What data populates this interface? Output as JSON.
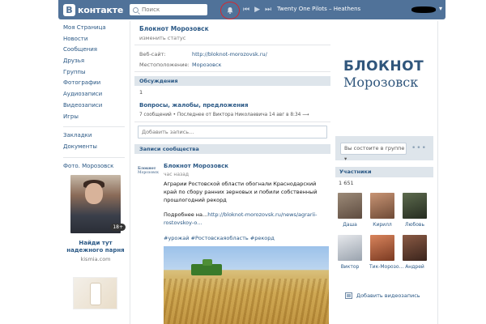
{
  "header": {
    "logo_letter": "В",
    "logo_text": "контакте",
    "search_placeholder": "Поиск",
    "track": "Twenty One Pilots – Heathens"
  },
  "sidebar": {
    "items": [
      "Моя Страница",
      "Новости",
      "Сообщения",
      "Друзья",
      "Группы",
      "Фотографии",
      "Аудиозаписи",
      "Видеозаписи",
      "Игры"
    ],
    "items2": [
      "Закладки",
      "Документы"
    ],
    "items3": [
      "Фото. Морозовск"
    ],
    "ad": {
      "age": "18+",
      "title": "Найди тут надежного парня",
      "domain": "kismia.com"
    }
  },
  "group": {
    "name": "Блокнот Морозовск",
    "status": "изменить статус",
    "website_label": "Веб-сайт:",
    "website_value": "http://bloknot-morozovsk.ru/",
    "location_label": "Местоположение:",
    "location_value": "Морозовск"
  },
  "discussions": {
    "header": "Обсуждения",
    "count": "1",
    "topic_title": "Вопросы, жалобы, предложения",
    "topic_count": "7 сообщений",
    "topic_last": "Последнее от Виктора Николаевича 14 авг в 8:34"
  },
  "wall": {
    "input_placeholder": "Добавить запись...",
    "header": "Записи сообщества",
    "post": {
      "avatar_line1": "Блокнот",
      "avatar_line2": "Морозовск",
      "author": "Блокнот Морозовск",
      "time": "час назад",
      "text": "Аграрии Ростовской области обогнали Краснодарский край по сбору ранних зерновых и побили собственный прошлогодний рекорд",
      "more_prefix": "Подробнее на...",
      "more_link": "http://bloknot-morozovsk.ru/news/agrarii-rostovskoy-o...",
      "tags": "#урожай #Ростовскаяобласть #рекорд"
    }
  },
  "right": {
    "cover_line1": "БЛОКНОТ",
    "cover_line2": "Морозовск",
    "join_label": "Вы состоите в группе ▾",
    "more_dots": "•••",
    "members_header": "Участники",
    "members_count": "1 651",
    "members": [
      {
        "name": "Даша",
        "color": "#7a6a5c"
      },
      {
        "name": "Кирилл",
        "color": "#a36b4a"
      },
      {
        "name": "Любовь",
        "color": "#3f4a35"
      },
      {
        "name": "Виктор",
        "color": "#c2c7cf"
      },
      {
        "name": "Тик-Морозо...",
        "color": "#a65a3c"
      },
      {
        "name": "Андрей",
        "color": "#5a3a2c"
      }
    ],
    "add_video": "Добавить видеозапись"
  },
  "colors": {
    "brand": "#507299",
    "link": "#2a5885",
    "section_bg": "#dee5eb",
    "highlight_circle": "#d8262c"
  }
}
